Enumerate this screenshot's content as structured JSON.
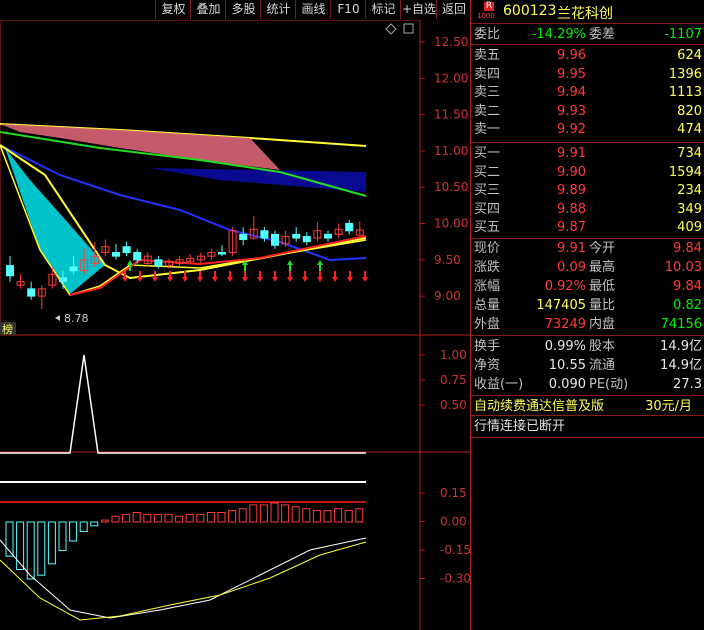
{
  "toolbar": {
    "buttons": [
      "复权",
      "叠加",
      "多股",
      "统计",
      "画线",
      "F10",
      "标记",
      "+自选",
      "返回"
    ]
  },
  "stock": {
    "badge_top": "R",
    "badge_bottom": "1000",
    "code": "600123",
    "name": "兰花科创"
  },
  "order_ratio": {
    "label1": "委比",
    "value1": "-14.29%",
    "label2": "委差",
    "value2": "-1107"
  },
  "asks": [
    {
      "label": "卖五",
      "price": "9.96",
      "volume": "624"
    },
    {
      "label": "卖四",
      "price": "9.95",
      "volume": "1396"
    },
    {
      "label": "卖三",
      "price": "9.94",
      "volume": "1113"
    },
    {
      "label": "卖二",
      "price": "9.93",
      "volume": "820"
    },
    {
      "label": "卖一",
      "price": "9.92",
      "volume": "474"
    }
  ],
  "bids": [
    {
      "label": "买一",
      "price": "9.91",
      "volume": "734"
    },
    {
      "label": "买二",
      "price": "9.90",
      "volume": "1594"
    },
    {
      "label": "买三",
      "price": "9.89",
      "volume": "234"
    },
    {
      "label": "买四",
      "price": "9.88",
      "volume": "349"
    },
    {
      "label": "买五",
      "price": "9.87",
      "volume": "409"
    }
  ],
  "stats": [
    {
      "l1": "现价",
      "v1": "9.91",
      "c1": "red",
      "l2": "今开",
      "v2": "9.84",
      "c2": "red"
    },
    {
      "l1": "涨跌",
      "v1": "0.09",
      "c1": "red",
      "l2": "最高",
      "v2": "10.03",
      "c2": "red"
    },
    {
      "l1": "涨幅",
      "v1": "0.92%",
      "c1": "red",
      "l2": "最低",
      "v2": "9.84",
      "c2": "red"
    },
    {
      "l1": "总量",
      "v1": "147405",
      "c1": "yellow",
      "l2": "量比",
      "v2": "0.82",
      "c2": "green"
    },
    {
      "l1": "外盘",
      "v1": "73249",
      "c1": "red",
      "l2": "内盘",
      "v2": "74156",
      "c2": "green"
    }
  ],
  "stats2": [
    {
      "l1": "换手",
      "v1": "0.99%",
      "l2": "股本",
      "v2": "14.9亿"
    },
    {
      "l1": "净资",
      "v1": "10.55",
      "l2": "流通",
      "v2": "14.9亿"
    },
    {
      "l1": "收益(一)",
      "v1": "0.090",
      "l2": "PE(动)",
      "v2": "27.3"
    }
  ],
  "ad": {
    "text": "自动续费通达信普及版",
    "price": "30元/月"
  },
  "status": {
    "text": "行情连接已断开"
  },
  "side_label": "榜",
  "main_axis": [
    "12.50",
    "12.00",
    "11.50",
    "11.00",
    "10.50",
    "10.00",
    "9.50",
    "9.00"
  ],
  "mid_axis": [
    "1.00",
    "0.75",
    "0.50"
  ],
  "low_axis": [
    "0.15",
    "0.00",
    "-0.15",
    "-0.30"
  ],
  "low_price_label": "8.78",
  "colors": {
    "up": "#ff3b3b",
    "down": "#54ffff",
    "grid": "#b02020",
    "ma_yellow": "#ffff33",
    "ma_blue": "#2233ff",
    "ma_green": "#22dd22"
  },
  "chart_data": {
    "type": "candlestick",
    "ylim": [
      8.7,
      12.7
    ],
    "candles": [
      {
        "o": 9.42,
        "c": 9.28,
        "h": 9.55,
        "l": 9.2
      },
      {
        "o": 9.15,
        "c": 9.2,
        "h": 9.3,
        "l": 9.1
      },
      {
        "o": 9.1,
        "c": 9.0,
        "h": 9.2,
        "l": 8.95
      },
      {
        "o": 9.0,
        "c": 9.1,
        "h": 9.15,
        "l": 8.82
      },
      {
        "o": 9.15,
        "c": 9.3,
        "h": 9.4,
        "l": 9.1
      },
      {
        "o": 9.25,
        "c": 9.2,
        "h": 9.35,
        "l": 9.1
      },
      {
        "o": 9.4,
        "c": 9.35,
        "h": 9.55,
        "l": 9.3
      },
      {
        "o": 9.35,
        "c": 9.5,
        "h": 9.65,
        "l": 9.3
      },
      {
        "o": 9.45,
        "c": 9.55,
        "h": 9.75,
        "l": 9.4
      },
      {
        "o": 9.6,
        "c": 9.68,
        "h": 9.78,
        "l": 9.55
      },
      {
        "o": 9.6,
        "c": 9.55,
        "h": 9.72,
        "l": 9.5
      },
      {
        "o": 9.68,
        "c": 9.6,
        "h": 9.75,
        "l": 9.55
      },
      {
        "o": 9.6,
        "c": 9.5,
        "h": 9.65,
        "l": 9.45
      },
      {
        "o": 9.45,
        "c": 9.55,
        "h": 9.6,
        "l": 9.4
      },
      {
        "o": 9.5,
        "c": 9.42,
        "h": 9.55,
        "l": 9.38
      },
      {
        "o": 9.42,
        "c": 9.48,
        "h": 9.52,
        "l": 9.38
      },
      {
        "o": 9.45,
        "c": 9.5,
        "h": 9.55,
        "l": 9.4
      },
      {
        "o": 9.48,
        "c": 9.52,
        "h": 9.58,
        "l": 9.45
      },
      {
        "o": 9.5,
        "c": 9.55,
        "h": 9.6,
        "l": 9.45
      },
      {
        "o": 9.55,
        "c": 9.6,
        "h": 9.65,
        "l": 9.5
      },
      {
        "o": 9.6,
        "c": 9.58,
        "h": 9.7,
        "l": 9.55
      },
      {
        "o": 9.6,
        "c": 9.9,
        "h": 9.95,
        "l": 9.55
      },
      {
        "o": 9.85,
        "c": 9.78,
        "h": 9.95,
        "l": 9.7
      },
      {
        "o": 9.8,
        "c": 9.92,
        "h": 10.1,
        "l": 9.78
      },
      {
        "o": 9.9,
        "c": 9.8,
        "h": 9.95,
        "l": 9.75
      },
      {
        "o": 9.85,
        "c": 9.7,
        "h": 9.9,
        "l": 9.65
      },
      {
        "o": 9.72,
        "c": 9.82,
        "h": 9.9,
        "l": 9.68
      },
      {
        "o": 9.85,
        "c": 9.8,
        "h": 9.95,
        "l": 9.75
      },
      {
        "o": 9.82,
        "c": 9.75,
        "h": 9.88,
        "l": 9.7
      },
      {
        "o": 9.8,
        "c": 9.9,
        "h": 10.02,
        "l": 9.75
      },
      {
        "o": 9.85,
        "c": 9.8,
        "h": 9.9,
        "l": 9.75
      },
      {
        "o": 9.85,
        "c": 9.92,
        "h": 10.0,
        "l": 9.8
      },
      {
        "o": 10.0,
        "c": 9.9,
        "h": 10.05,
        "l": 9.85
      },
      {
        "o": 9.84,
        "c": 9.91,
        "h": 10.03,
        "l": 9.84
      }
    ],
    "macd_hist": [
      -0.18,
      -0.25,
      -0.3,
      -0.28,
      -0.22,
      -0.15,
      -0.1,
      -0.05,
      -0.02,
      0.01,
      0.03,
      0.04,
      0.05,
      0.04,
      0.04,
      0.04,
      0.03,
      0.04,
      0.04,
      0.05,
      0.05,
      0.06,
      0.07,
      0.09,
      0.09,
      0.1,
      0.09,
      0.08,
      0.07,
      0.06,
      0.06,
      0.07,
      0.06,
      0.07
    ]
  }
}
